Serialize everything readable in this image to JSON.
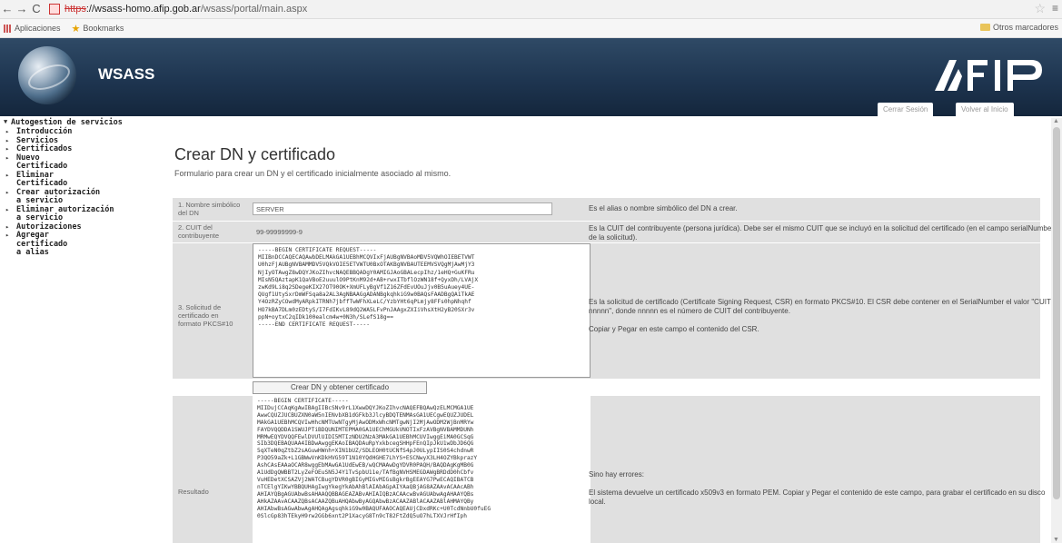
{
  "browser": {
    "back": "←",
    "forward": "→",
    "reload": "C",
    "url_scheme": "https",
    "url_host": "://wsass-homo.afip.gob.ar",
    "url_path": "/wsass/portal/main.aspx",
    "bookmarks": [
      "Aplicaciones",
      "Bookmarks"
    ],
    "other_bookmarks": "Otros marcadores"
  },
  "header": {
    "title": "WSASS",
    "logo_text": "AFIP",
    "tabs": [
      "Cerrar Sesión",
      "Volver al Inicio"
    ]
  },
  "sidebar": {
    "root": "Autogestion de servicios",
    "items": [
      {
        "label": "Introducción"
      },
      {
        "label": "Servicios"
      },
      {
        "label": "Certificados"
      },
      {
        "label": "Nuevo\nCertificado"
      },
      {
        "label": "Eliminar\nCertificado"
      },
      {
        "label": "Crear autorización\na servicio"
      },
      {
        "label": "Eliminar autorización\na servicio"
      },
      {
        "label": "Autorizaciones"
      },
      {
        "label": "Agregar\ncertificado\na alias"
      }
    ]
  },
  "main": {
    "title": "Crear DN y certificado",
    "description": "Formulario para crear un DN y el certificado inicialmente asociado al mismo.",
    "field1": {
      "label": "1. Nombre simbólico\ndel DN",
      "value": "SERVER",
      "help": "Es el alias o nombre simbólico del DN a crear."
    },
    "field2": {
      "label": "2. CUIT del\ncontribuyente",
      "value": "99-99999999-9",
      "help": "Es la CUIT del contribuyente (persona jurídica). Debe ser el mismo CUIT que se incluyó en la solicitud del certificado (en el campo serialNumber\nde la solicitud)."
    },
    "field3": {
      "label": "3. Solicitud de\ncertificado en\nformato PKCS#10",
      "value": "-----BEGIN CERTIFICATE REQUEST-----\nMIIBnDCCAQECAQAwbDELMAkGA1UEBhMCQVIxFjAUBgNVBAoMDV5VQWhOIEBETVWT\nU0hzFjAUBgNVBAMMDV5VQkVOIE5ETVWTU0BxOTAKBgNVBAUTEEMVSVQgMjAwMjY3\nNjIyOTAwgZ8wDQYJKoZIhvcNAQEBBQADgY0AMIGJAoGBALecpIhz/1eHQ+GuKFRu\nMIsN5QAztapK1QaVBoE2uuulO9PtKnM92d+AB+rwxITbflOzWN18f+QyxDh/LVAjX\nzwKd9Li8q2SDegeKIX27OT90OK+XmUFLyBgVf1Z16ZFdEvUOuJjv0B5uAuey4UE-\nQUgf1UtySxrDmWFSqa8a2AL3AgNBAAGgADANBgkqhkiG9w0BAQsFAADBgQA1TkAE\nY4OzRZyCOwdMyARpkITRNh7jbffTwWFhXLeLC/YzbYHt6qPLmjy8FFs0hpNhqhf\nHO7kBA7DLm0zEDtyS/I7FdIKvL89dQ2WA5LFvPnJAAgxZXIiVhsXtH2yB20SXr3v\nppN+oytxC2qIDk100ealcm4w+0N3h/SLefS18g==\n-----END CERTIFICATE REQUEST-----",
      "help": "Es la solicitud de certificado (Certificate Signing Request, CSR) en formato PKCS#10. El CSR debe contener en el SerialNumber el valor \"CUIT\nnnnnn\", donde nnnnn es el número de CUIT del contribuyente.\n\nCopiar y Pegar en este campo el contenido del CSR."
    },
    "submit_label": "Crear DN y obtener certificado",
    "result": {
      "label": "Resultado",
      "value": "-----BEGIN CERTIFICATE-----\nMIIDujCCAqKgAwIBAgIIBcSNv9rL1XwwDQYJKoZIhvcNAQEFBQAwQzELMCMGA1UE\nAwwCQUZJUCBUZXN0aW5nIENvbXB1dGFkb3JlcyBDQTENMAsGA1UECgwEQUZJUDEL\nMAkGA1UEBhMCQVIwHhcNMTUwNTgyMjAwODMxWhcNMTgwNjI2MjAwODM2WjBnMRYw\nFAYDVQQDDA1SWUJPTiBDQUNIMTEPMA0GA1UEChMGUkVNOTIxFzAVBgNVBAMMDUNh\nMRMwEQYDVQQFEwlDVUlUIDI5MTIzNDU2NzA3MAkGA1UEBhMCUVIwggEiMA0GCSqG\nSIb3DQEBAQUAA4IBDwAwggEKAoIBAQDAuRpYxkbcegSHHpFEnQIpJkU1wDbJD6QG\n5qXTeN0qZtbZ2sAGuwHWnh+XIN1bUZ/SDLEOH0tUCNfS4pJ0ULypIIS0S4chdnwR\nP3QO59aZk+L1GBWwVnKDkHVG59T1N10YQdHGHE7LhYS+ESCNwyX3LH4OZYBkprazY\nAshCAsEAAaOCAR8wggEbMAwGA1UdEwEB/wQCMAAwDgYDVR0PAQH/BAQDAgKgMB0G\nA1UdDgQWBBT2LyZeFOEuSN5J4Y1TvSpbU11e/TAfBgNVHSMEGDAWgBRDdD0hCbfv\nVuHEDetXCSAZVj2WATCBugYDVR0gBIGyMIGvMIGsBgkrBgEEAYG7PwECAQIBATCB\nnTCElgYIKwYBBQUHAgIwgYkegYkAbAhBlAIAbAGpAIYAaQBjAG8AZAAvACAAcABh\nAHIAYQBgAGUAbwBsAHAAQQBBAGEAZABvAHIAIQBzACAAcwBvAGUAbwAgAHAAYQBs\nAHkAZAAvACAAZQBsACAAZQBuAHQAbwByAGQAbwBzACAAZABlACAAZABlAHMAYQBy\nAHIAbwBsAGwAbwAgAHQAgAgsqhkiG9w0BAQUFAAOCAQEAUjCDxdRKc+U0TcdNnbU0fuEG\n0SlcGp83hTEkyH9rw2GGb6xnt2P1XacyG8Tn9cT82FtZdQ5uO7hLTXVJrHfIph",
      "help": "Sino hay errores:\n\nEl sistema devuelve un certificado x509v3 en formato PEM. Copiar y Pegar el contenido de este campo, para grabar el certificado en su disco\nlocal."
    }
  }
}
